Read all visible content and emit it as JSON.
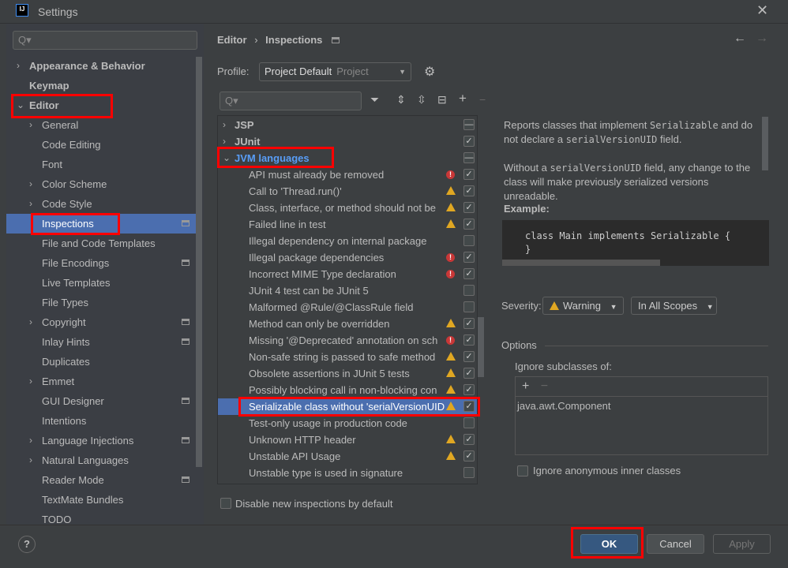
{
  "window": {
    "title": "Settings",
    "logo": "IJ",
    "close_icon": "close-icon"
  },
  "sidebar": {
    "search_placeholder": "Q▾",
    "items": [
      {
        "label": "Appearance & Behavior",
        "level": 0,
        "arrow": "right",
        "bold": true
      },
      {
        "label": "Keymap",
        "level": 0,
        "bold": true
      },
      {
        "label": "Editor",
        "level": 0,
        "arrow": "down",
        "bold": true
      },
      {
        "label": "General",
        "level": 1,
        "arrow": "right"
      },
      {
        "label": "Code Editing",
        "level": 1
      },
      {
        "label": "Font",
        "level": 1
      },
      {
        "label": "Color Scheme",
        "level": 1,
        "arrow": "right"
      },
      {
        "label": "Code Style",
        "level": 1,
        "arrow": "right"
      },
      {
        "label": "Inspections",
        "level": 1,
        "selected": true,
        "project_icon": true
      },
      {
        "label": "File and Code Templates",
        "level": 1
      },
      {
        "label": "File Encodings",
        "level": 1,
        "project_icon": true
      },
      {
        "label": "Live Templates",
        "level": 1
      },
      {
        "label": "File Types",
        "level": 1
      },
      {
        "label": "Copyright",
        "level": 1,
        "arrow": "right",
        "project_icon": true
      },
      {
        "label": "Inlay Hints",
        "level": 1,
        "project_icon": true
      },
      {
        "label": "Duplicates",
        "level": 1
      },
      {
        "label": "Emmet",
        "level": 1,
        "arrow": "right"
      },
      {
        "label": "GUI Designer",
        "level": 1,
        "project_icon": true
      },
      {
        "label": "Intentions",
        "level": 1
      },
      {
        "label": "Language Injections",
        "level": 1,
        "arrow": "right",
        "project_icon": true
      },
      {
        "label": "Natural Languages",
        "level": 1,
        "arrow": "right"
      },
      {
        "label": "Reader Mode",
        "level": 1,
        "project_icon": true
      },
      {
        "label": "TextMate Bundles",
        "level": 1
      },
      {
        "label": "TODO",
        "level": 1
      }
    ]
  },
  "header": {
    "breadcrumb": [
      "Editor",
      "Inspections"
    ],
    "sep": "›",
    "back": "←",
    "forward": "→"
  },
  "profile": {
    "label": "Profile:",
    "value": "Project Default",
    "scope": "Project"
  },
  "toolbar": {
    "search_placeholder": "Q▾",
    "filter": "⏷",
    "expand": "⇕",
    "collapse": "⇳",
    "reset": "⊟",
    "add": "+",
    "remove": "−"
  },
  "tree": [
    {
      "label": "JSP",
      "group": true,
      "arrow": "›",
      "check": "mixed"
    },
    {
      "label": "JUnit",
      "group": true,
      "arrow": "›",
      "check": "checked"
    },
    {
      "label": "JVM languages",
      "group": true,
      "arrow": "⌄",
      "check": "mixed",
      "color": "#589df6"
    },
    {
      "label": "API must already be removed",
      "severity": "error",
      "check": "checked"
    },
    {
      "label": "Call to 'Thread.run()'",
      "severity": "warning",
      "check": "checked"
    },
    {
      "label": "Class, interface, or method should not be",
      "severity": "warning",
      "check": "checked"
    },
    {
      "label": "Failed line in test",
      "severity": "warning",
      "check": "checked"
    },
    {
      "label": "Illegal dependency on internal package",
      "check": "unchecked"
    },
    {
      "label": "Illegal package dependencies",
      "severity": "error",
      "check": "checked"
    },
    {
      "label": "Incorrect MIME Type declaration",
      "severity": "error",
      "check": "checked"
    },
    {
      "label": "JUnit 4 test can be JUnit 5",
      "check": "unchecked"
    },
    {
      "label": "Malformed @Rule/@ClassRule field",
      "check": "unchecked"
    },
    {
      "label": "Method can only be overridden",
      "severity": "warning",
      "check": "checked"
    },
    {
      "label": "Missing '@Deprecated' annotation on sch",
      "severity": "error",
      "check": "checked"
    },
    {
      "label": "Non-safe string is passed to safe method",
      "severity": "warning",
      "check": "checked"
    },
    {
      "label": "Obsolete assertions in JUnit 5 tests",
      "severity": "warning",
      "check": "checked"
    },
    {
      "label": "Possibly blocking call in non-blocking con",
      "severity": "warning",
      "check": "checked"
    },
    {
      "label": "Serializable class without 'serialVersionUID",
      "severity": "warning",
      "check": "checked",
      "selected": true
    },
    {
      "label": "Test-only usage in production code",
      "check": "unchecked"
    },
    {
      "label": "Unknown HTTP header",
      "severity": "warning",
      "check": "checked"
    },
    {
      "label": "Unstable API Usage",
      "severity": "warning",
      "check": "checked"
    },
    {
      "label": "Unstable type is used in signature",
      "check": "unchecked"
    }
  ],
  "disable_new": {
    "label": "Disable new inspections by default",
    "checked": false
  },
  "description": {
    "p1a": "Reports classes that implement ",
    "p1b": "Serializable",
    "p1c": " and do not declare a ",
    "p1d": "serialVersionUID",
    "p1e": " field.",
    "p2a": "Without a ",
    "p2b": "serialVersionUID",
    "p2c": " field, any change to the class will make previously serialized versions unreadable.",
    "example_title": "Example:",
    "code_line1": "class Main implements Serializable {",
    "code_line2": "}"
  },
  "severity": {
    "label": "Severity:",
    "value": "Warning",
    "scope": "In All Scopes"
  },
  "options": {
    "title": "Options",
    "ignore_label": "Ignore subclasses of:",
    "add": "+",
    "remove": "−",
    "classes": [
      "java.awt.Component"
    ],
    "anon_label": "Ignore anonymous inner classes",
    "anon_checked": false
  },
  "buttons": {
    "help": "?",
    "ok": "OK",
    "cancel": "Cancel",
    "apply": "Apply"
  },
  "colors": {
    "selection": "#4b6eaf",
    "highlight": "#ff0000",
    "warning": "#e0a722",
    "error": "#c83737",
    "link": "#589df6"
  }
}
